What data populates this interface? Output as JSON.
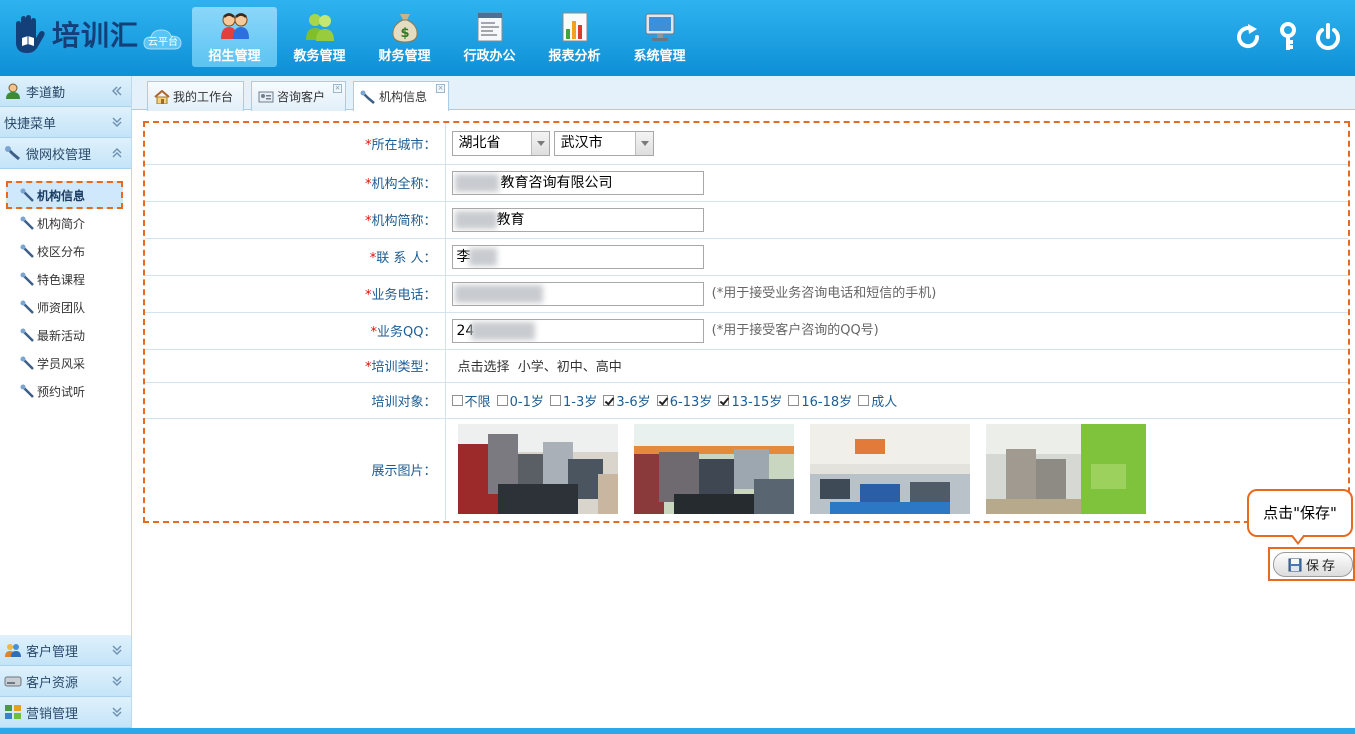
{
  "app": {
    "brand": "培训汇",
    "badge": "云平台"
  },
  "nav": [
    {
      "label": "招生管理",
      "icon": "users-icon",
      "active": true
    },
    {
      "label": "教务管理",
      "icon": "people-icon"
    },
    {
      "label": "财务管理",
      "icon": "money-bag-icon"
    },
    {
      "label": "行政办公",
      "icon": "document-icon"
    },
    {
      "label": "报表分析",
      "icon": "bar-chart-icon"
    },
    {
      "label": "系统管理",
      "icon": "monitor-icon"
    }
  ],
  "tools": [
    "refresh-icon",
    "key-icon",
    "power-icon"
  ],
  "sidebar": {
    "user": "李道勤",
    "quick_menu": "快捷菜单",
    "section": "微网校管理",
    "items": [
      {
        "label": "机构信息",
        "active": true
      },
      {
        "label": "机构简介"
      },
      {
        "label": "校区分布"
      },
      {
        "label": "特色课程"
      },
      {
        "label": "师资团队"
      },
      {
        "label": "最新活动"
      },
      {
        "label": "学员风采"
      },
      {
        "label": "预约试听"
      }
    ],
    "bottom": [
      {
        "label": "客户管理"
      },
      {
        "label": "客户资源"
      },
      {
        "label": "营销管理"
      }
    ]
  },
  "tabs": [
    {
      "label": "我的工作台"
    },
    {
      "label": "咨询客户"
    },
    {
      "label": "机构信息",
      "active": true
    }
  ],
  "form": {
    "city": {
      "label": "所在城市：",
      "province": "湖北省",
      "city": "武汉市"
    },
    "full_name": {
      "label": "机构全称：",
      "value": "教育咨询有限公司"
    },
    "short_name": {
      "label": "机构简称：",
      "value": "教育"
    },
    "contact": {
      "label": "联 系 人：",
      "value": "李"
    },
    "phone": {
      "label": "业务电话：",
      "value": "",
      "hint": "(*用于接受业务咨询电话和短信的手机)"
    },
    "qq": {
      "label": "业务QQ：",
      "value": "24",
      "hint": "(*用于接受客户咨询的QQ号)"
    },
    "type": {
      "label": "培训类型：",
      "value": "点击选择  小学、初中、高中"
    },
    "target": {
      "label": "培训对象：",
      "options": [
        {
          "label": "不限",
          "checked": false
        },
        {
          "label": "0-1岁",
          "checked": false
        },
        {
          "label": "1-3岁",
          "checked": false
        },
        {
          "label": "3-6岁",
          "checked": true
        },
        {
          "label": "6-13岁",
          "checked": true
        },
        {
          "label": "13-15岁",
          "checked": true
        },
        {
          "label": "16-18岁",
          "checked": false
        },
        {
          "label": "成人",
          "checked": false
        }
      ]
    },
    "pictures": {
      "label": "展示图片：",
      "count": 4
    }
  },
  "callout": "点击\"保存\"",
  "save_label": "保存",
  "colors": {
    "accent": "#e96a1d",
    "header": "#1da2e6",
    "label": "#1d5d94",
    "required": "#e30b0b"
  }
}
